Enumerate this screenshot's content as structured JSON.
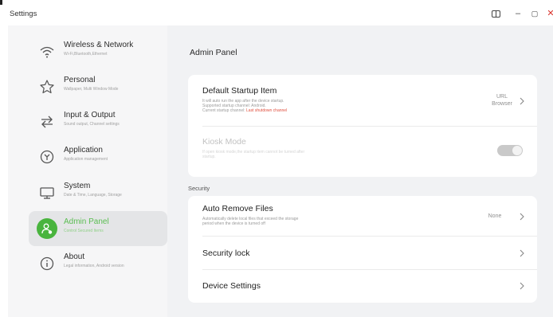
{
  "window": {
    "title": "Settings",
    "buttons": {
      "layout_icon": "split-window-icon",
      "minimize": "–",
      "maximize": "▢",
      "close": "✕"
    }
  },
  "sidebar": {
    "items": [
      {
        "label": "Wireless & Network",
        "sub": "Wi-Fi,Bluetooth,Ethernet",
        "icon": "wifi-icon"
      },
      {
        "label": "Personal",
        "sub": "Wallpaper, Multi Window Mode",
        "icon": "star-icon"
      },
      {
        "label": "Input & Output",
        "sub": "Sound output, Channel settings",
        "icon": "swap-arrows-icon"
      },
      {
        "label": "Application",
        "sub": "Application management",
        "icon": "application-icon"
      },
      {
        "label": "System",
        "sub": "Date & Time, Language, Storage",
        "icon": "monitor-icon"
      },
      {
        "label": "Admin Panel",
        "sub": "Control Secured Items",
        "icon": "admin-user-icon",
        "active": true
      },
      {
        "label": "About",
        "sub": "Legal information, Android version",
        "icon": "info-icon"
      }
    ]
  },
  "main": {
    "title": "Admin Panel",
    "startup": {
      "label": "Default Startup Item",
      "desc_lines": [
        "It will auto run the app after the device startup.",
        "Supported startup channel: Android.",
        "Current startup channel: "
      ],
      "desc_link": "Last shutdown channel",
      "value_line1": "URL",
      "value_line2": "Browser"
    },
    "kiosk": {
      "label": "Kiosk Mode",
      "desc_lines": [
        "If open kiosk mode,the startup item cannot be turned after",
        "startup."
      ],
      "enabled": false
    },
    "security_section": "Security",
    "auto_remove": {
      "label": "Auto Remove Files",
      "desc_lines": [
        "Automatically delete local files that exceed the storage",
        "period when the device is turned off"
      ],
      "value": "None"
    },
    "security_lock": {
      "label": "Security lock"
    },
    "device_settings": {
      "label": "Device Settings"
    }
  },
  "colors": {
    "accent": "#49b43e",
    "link": "#e0503f",
    "close": "#d9332c"
  }
}
